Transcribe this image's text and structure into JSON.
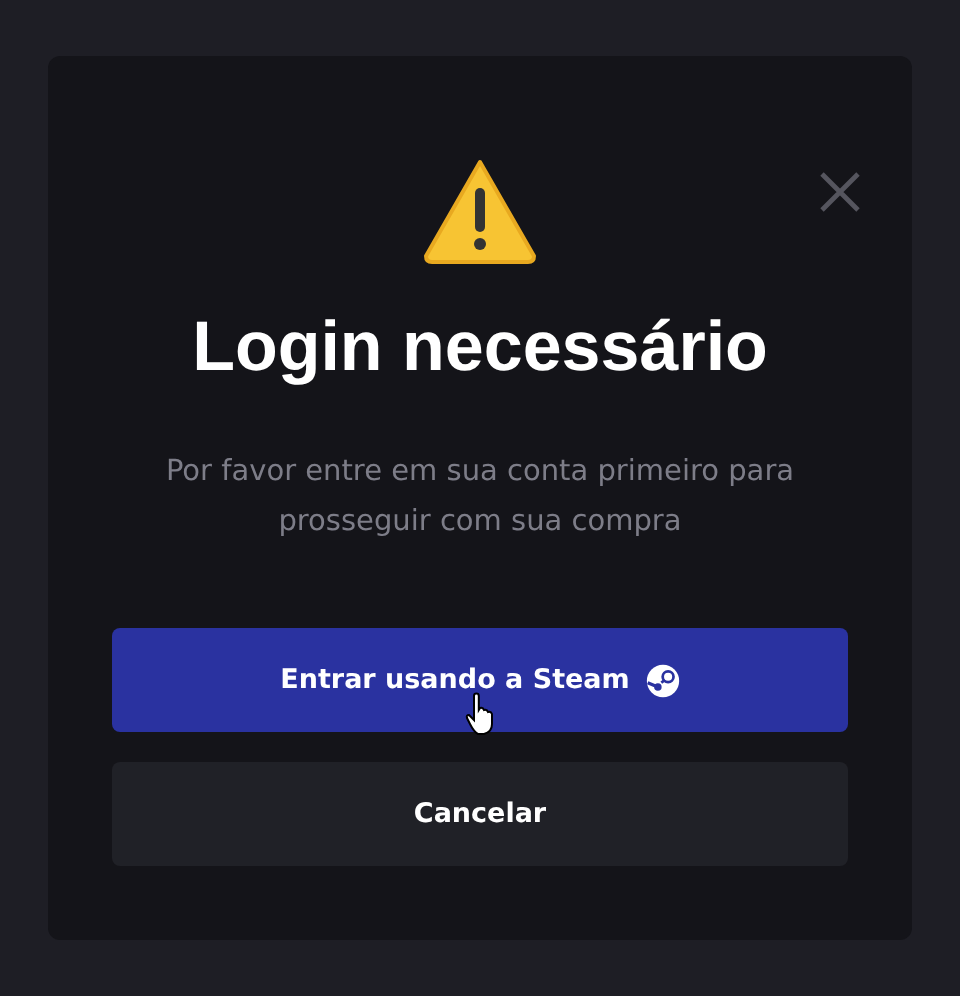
{
  "dialog": {
    "title": "Login necessário",
    "message": "Por favor entre em sua conta primeiro para prosseguir com sua compra",
    "buttons": [
      {
        "label": "Entrar usando a Steam",
        "kind": "primary"
      },
      {
        "label": "Cancelar",
        "kind": "secondary"
      }
    ]
  }
}
